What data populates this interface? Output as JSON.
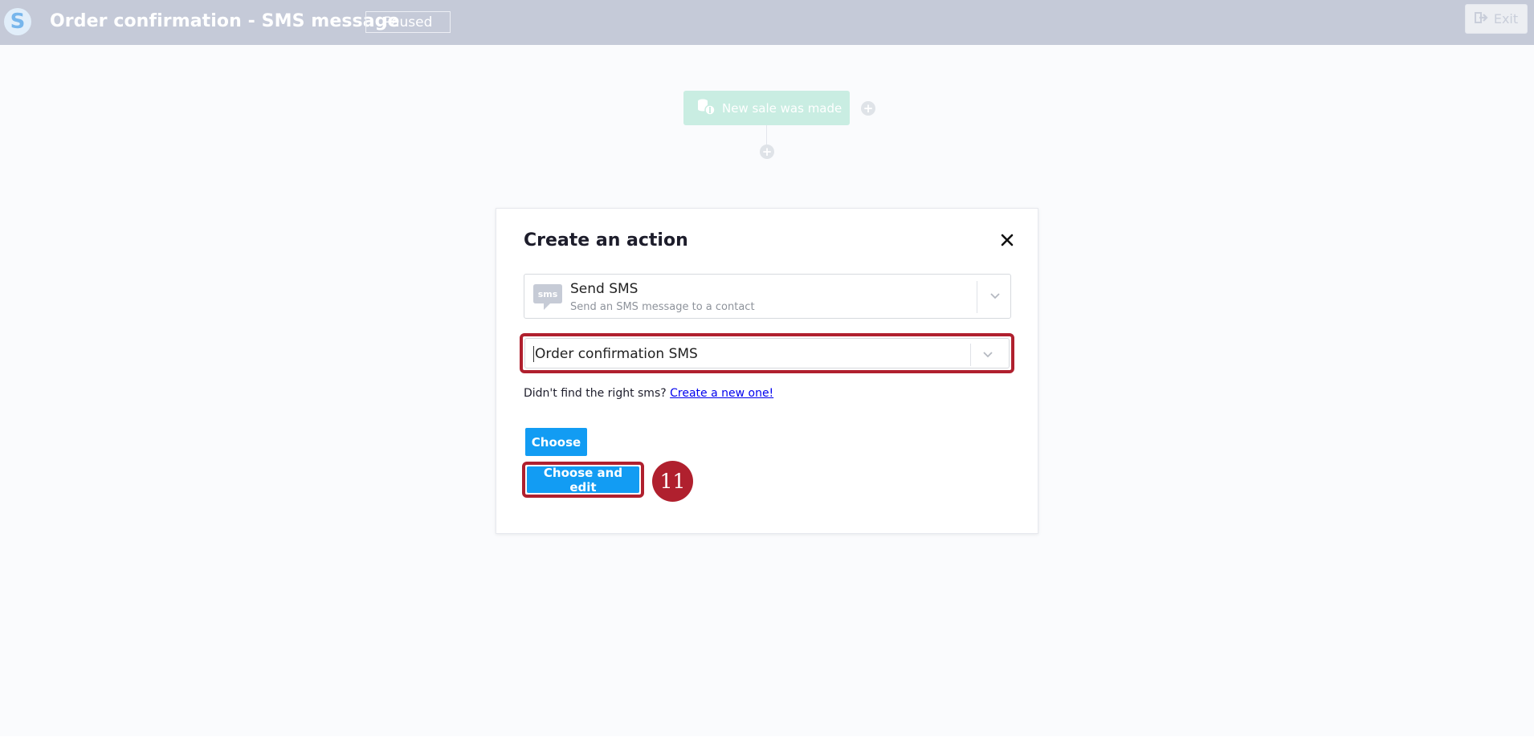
{
  "header": {
    "logo_letter": "S",
    "title": "Order confirmation - SMS message",
    "status": "Paused",
    "exit_label": "Exit"
  },
  "flow": {
    "trigger_label": "New sale was made"
  },
  "modal": {
    "title": "Create an action",
    "action_select": {
      "name": "Send SMS",
      "description": "Send an SMS message to a contact",
      "icon_text": "sms"
    },
    "sms_select": {
      "value": "Order confirmation SMS"
    },
    "helper_text": "Didn't find the right sms? ",
    "helper_link": "Create a new one!",
    "choose_label": "Choose",
    "choose_edit_label": "Choose and edit",
    "step_number": "11"
  },
  "colors": {
    "topbar": "#c5cad8",
    "primary": "#129cf3",
    "highlight": "#b0202e",
    "trigger": "#c9ede2"
  }
}
